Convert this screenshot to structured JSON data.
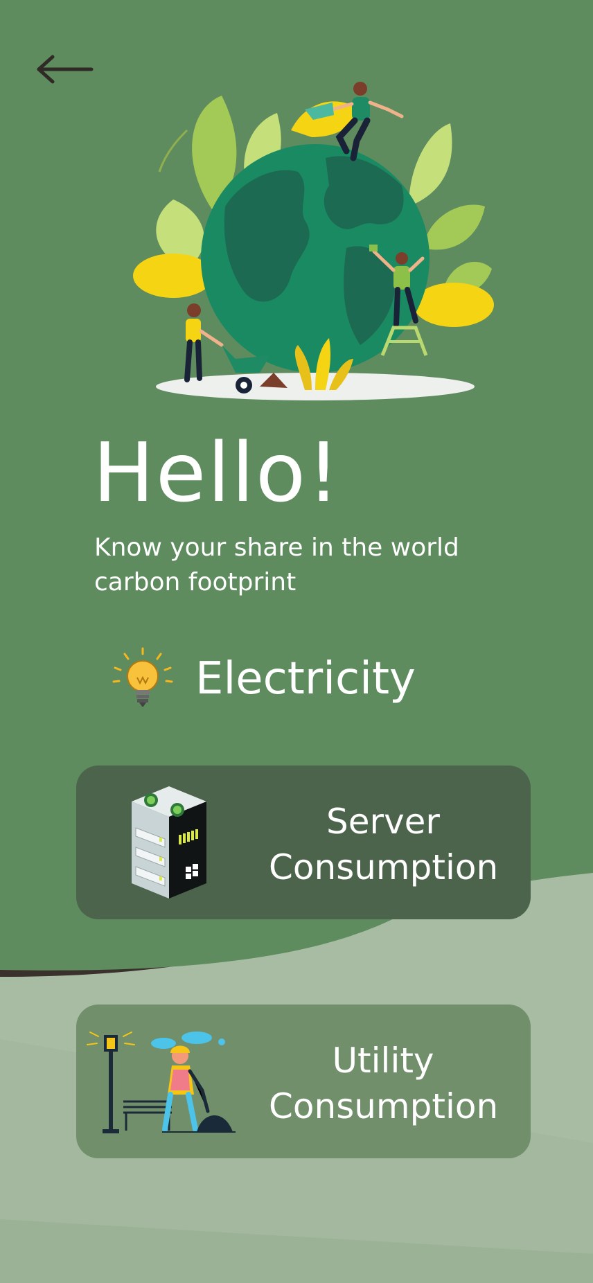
{
  "header": {
    "back_label": "Back"
  },
  "hero": {
    "illustration": "earth-gardening-people-illustration"
  },
  "greeting": {
    "title": "Hello!",
    "subtitle": "Know your share in the world carbon footprint"
  },
  "electricity": {
    "icon": "lightbulb-icon",
    "label": "Electricity"
  },
  "cards": [
    {
      "icon": "server-rack-icon",
      "label": "Server Consumption",
      "bg": "#4d644c"
    },
    {
      "icon": "utility-worker-icon",
      "label": "Utility Consumption",
      "bg": "#718f6b"
    }
  ],
  "colors": {
    "primary_green": "#5e8c5e",
    "wave_dark": "#3a302c",
    "bottom_bg": "#a8bca4",
    "text": "#ffffff"
  }
}
